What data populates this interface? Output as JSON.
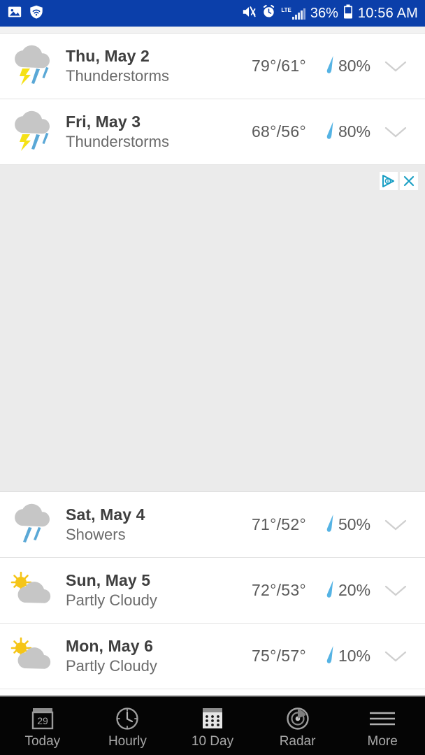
{
  "status_bar": {
    "background_color": "#0b3faa",
    "left_icons": [
      {
        "name": "image-icon",
        "label": "screenshot"
      },
      {
        "name": "wifi-shield-icon",
        "label": "secure-wifi"
      }
    ],
    "right_icons": [
      {
        "name": "mute-icon",
        "label": "sound-off"
      },
      {
        "name": "alarm-icon",
        "label": "alarm-set"
      }
    ],
    "network_type": "LTE",
    "battery_percent": "36%",
    "time": "10:56 AM"
  },
  "forecast": {
    "rows": [
      {
        "day": "Thu, May 2",
        "condition": "Thunderstorms",
        "icon": "thunderstorm-icon",
        "temps": "79°/61°",
        "precip": "80%",
        "chevron": "chevron-down-icon"
      },
      {
        "day": "Fri, May 3",
        "condition": "Thunderstorms",
        "icon": "thunderstorm-icon",
        "temps": "68°/56°",
        "precip": "80%",
        "chevron": "chevron-down-icon"
      },
      {
        "day": "Sat, May 4",
        "condition": "Showers",
        "icon": "showers-icon",
        "temps": "71°/52°",
        "precip": "50%",
        "chevron": "chevron-down-icon"
      },
      {
        "day": "Sun, May 5",
        "condition": "Partly Cloudy",
        "icon": "partly-cloudy-icon",
        "temps": "72°/53°",
        "precip": "20%",
        "chevron": "chevron-down-icon"
      },
      {
        "day": "Mon, May 6",
        "condition": "Partly Cloudy",
        "icon": "partly-cloudy-icon",
        "temps": "75°/57°",
        "precip": "10%",
        "chevron": "chevron-down-icon"
      }
    ]
  },
  "advertisement": {
    "background_color": "#ebebeb",
    "adchoices_icon": "adchoices-icon",
    "close_icon": "close-icon"
  },
  "bottom_nav": {
    "items": [
      {
        "label": "Today",
        "icon": "calendar-today-icon",
        "badge": "29"
      },
      {
        "label": "Hourly",
        "icon": "clock-icon"
      },
      {
        "label": "10 Day",
        "icon": "calendar-grid-icon"
      },
      {
        "label": "Radar",
        "icon": "radar-icon"
      },
      {
        "label": "More",
        "icon": "hamburger-menu-icon"
      }
    ]
  },
  "colors": {
    "status_blue": "#0b3faa",
    "precip_blue": "#55b3e4",
    "lightning_yellow": "#f5e117",
    "cloud_gray": "#c6c6c6",
    "sun_yellow": "#f5c518",
    "ad_gray": "#ebebeb",
    "nav_black": "#050505"
  }
}
